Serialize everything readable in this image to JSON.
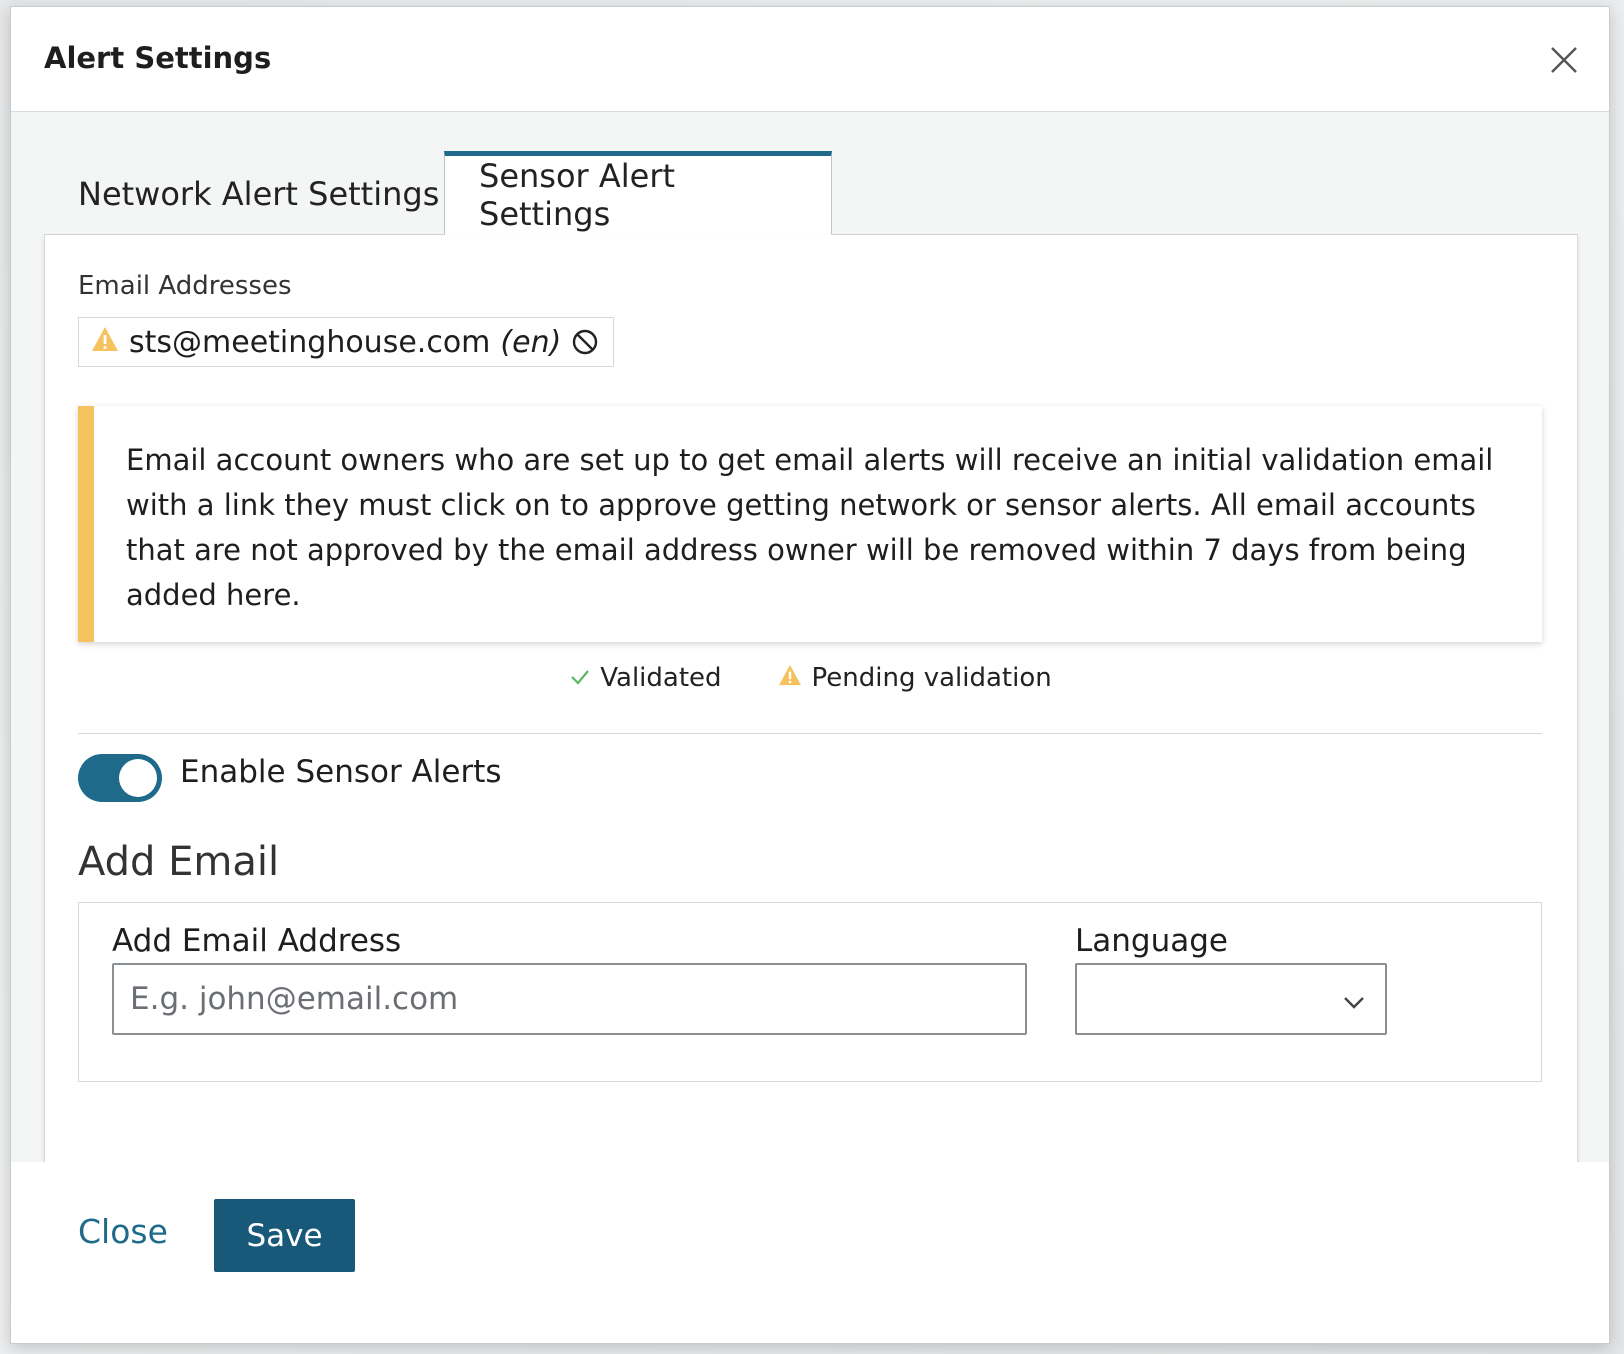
{
  "modal": {
    "title": "Alert Settings"
  },
  "tabs": [
    {
      "label": "Network Alert Settings",
      "active": false
    },
    {
      "label": "Sensor Alert Settings",
      "active": true
    }
  ],
  "emails": {
    "label": "Email Addresses",
    "items": [
      {
        "address": "sts@meetinghouse.com",
        "language": "(en)",
        "status": "pending"
      }
    ]
  },
  "notice": {
    "text": "Email account owners who are set up to get email alerts will receive an initial validation email with a link they must click on to approve getting network or sensor alerts. All email accounts that are not approved by the email address owner will be removed within 7 days from being added here."
  },
  "legend": {
    "validated": "Validated",
    "pending": "Pending validation"
  },
  "toggle": {
    "label": "Enable Sensor Alerts",
    "enabled": true
  },
  "add_email": {
    "section_title": "Add Email",
    "email_label": "Add Email Address",
    "email_placeholder": "E.g. john@email.com",
    "email_value": "",
    "language_label": "Language",
    "language_value": ""
  },
  "footer": {
    "close_label": "Close",
    "save_label": "Save"
  },
  "colors": {
    "accent": "#1f6a8a",
    "save_button": "#18597a",
    "warning": "#f6c25e",
    "validated": "#5cb85c"
  },
  "icons": {
    "close": "close-icon",
    "warning": "warning-icon",
    "remove": "block-icon",
    "check": "check-icon",
    "chevron": "chevron-down-icon"
  }
}
